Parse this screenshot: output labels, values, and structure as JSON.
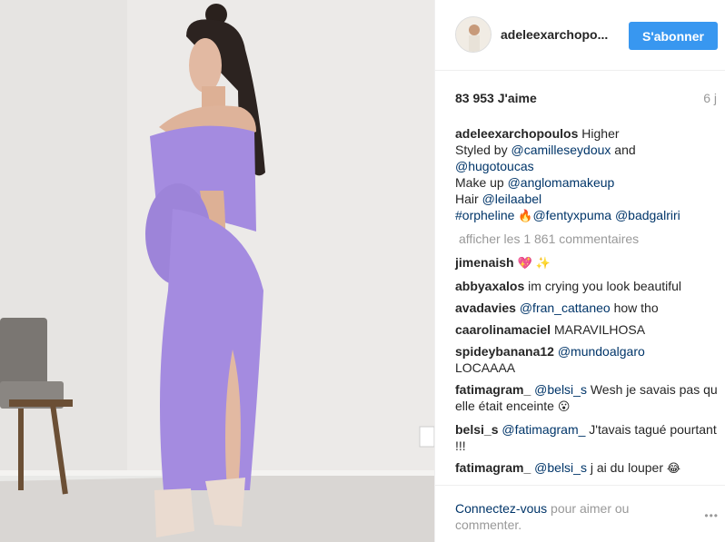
{
  "post": {
    "username": "adeleexarchopo...",
    "follow_label": "S'abonner",
    "likes": "83 953 J'aime",
    "time": "6 j",
    "caption": {
      "user": "adeleexarchopoulos",
      "line1_text": " Higher",
      "line2_prefix": "Styled by ",
      "line2_mention": "@camilleseydoux",
      "line2_suffix": " and",
      "line3_mention": "@hugotoucas",
      "line4_prefix": "Make up ",
      "line4_mention": "@anglomamakeup",
      "line5_prefix": "Hair ",
      "line5_mention": "@leilaabel",
      "line6_hashtag": "#orpheline",
      "line6_emoji": "🔥",
      "line6_mention1": "@fentyxpuma",
      "line6_mention2": "@badgalriri"
    },
    "view_all_comments": "afficher les 1 861 commentaires",
    "comments": [
      {
        "user": "jimenaish",
        "text": "",
        "emoji": "💖 ✨"
      },
      {
        "user": "abbyaxalos",
        "text": "im crying you look beautiful"
      },
      {
        "user": "avadavies",
        "mention": "@fran_cattaneo",
        "text": " how tho"
      },
      {
        "user": "caarolinamaciel",
        "text": "MARAVILHOSA"
      },
      {
        "user": "spideybanana12",
        "mention": "@mundoalgaro",
        "text": "LOCAAAA"
      },
      {
        "user": "fatimagram_",
        "mention": "@belsi_s",
        "text": " Wesh je savais pas qu elle était enceinte",
        "emoji": "😮"
      },
      {
        "user": "belsi_s",
        "mention": "@fatimagram_",
        "text": " J'tavais tagué pourtant !!!"
      },
      {
        "user": "fatimagram_",
        "mention": "@belsi_s",
        "text": " j ai du louper",
        "emoji": "😂"
      }
    ],
    "footer": {
      "login_link": "Connectez-vous",
      "login_text": " pour aimer ou commenter.",
      "more_icon": "•••"
    }
  },
  "icons": {
    "more": "ellipsis-icon"
  },
  "colors": {
    "follow_button": "#3897f0",
    "mention": "#003569",
    "muted": "#999999",
    "dress": "#a48be0"
  }
}
